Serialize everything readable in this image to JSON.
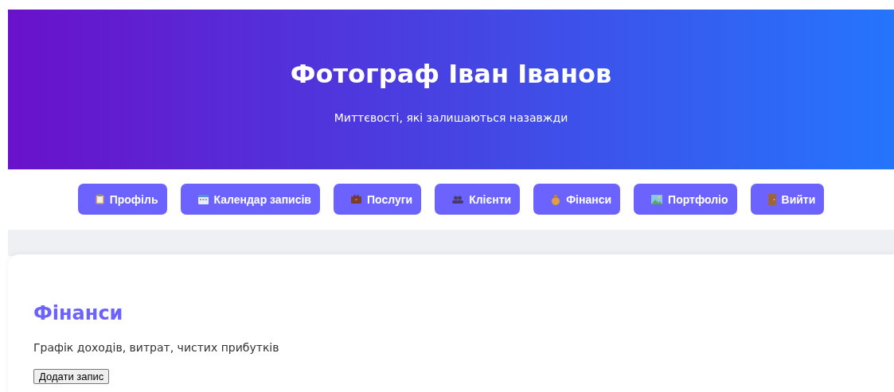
{
  "header": {
    "title": "Фотограф Іван Іванов",
    "subtitle": "Миттєвості, які залишаються назавжди"
  },
  "nav": [
    {
      "label": "Профіль"
    },
    {
      "label": "Календар записів"
    },
    {
      "label": "Послуги"
    },
    {
      "label": "Клієнти"
    },
    {
      "label": "Фінанси"
    },
    {
      "label": "Портфоліо"
    },
    {
      "label": "Вийти"
    }
  ],
  "section": {
    "title": "Фінанси",
    "description": "Графік доходів, витрат, чистих прибутків",
    "button": "Додати запис"
  }
}
